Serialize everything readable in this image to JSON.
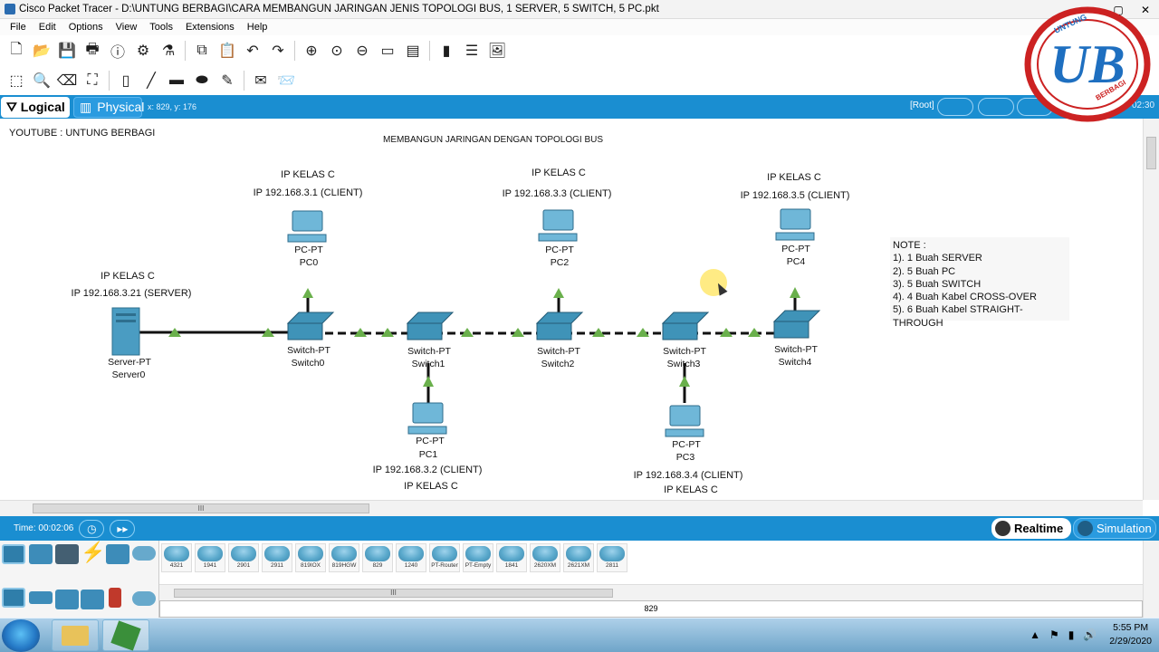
{
  "window": {
    "title": "Cisco Packet Tracer - D:\\UNTUNG BERBAGI\\CARA MEMBANGUN JARINGAN JENIS TOPOLOGI BUS, 1 SERVER, 5 SWITCH, 5 PC.pkt"
  },
  "menu": [
    "File",
    "Edit",
    "Options",
    "View",
    "Tools",
    "Extensions",
    "Help"
  ],
  "workspace": {
    "logical": "Logical",
    "physical": "Physical",
    "coords": "x: 829, y: 176",
    "root": "[Root]",
    "clock_partial": "02:30"
  },
  "canvas": {
    "youtube_label": "YOUTUBE : UNTUNG BERBAGI",
    "heading": "MEMBANGUN JARINGAN DENGAN TOPOLOGI BUS",
    "pc0": {
      "class": "IP KELAS C",
      "ip": "IP 192.168.3.1 (CLIENT)",
      "type": "PC-PT",
      "name": "PC0"
    },
    "pc2": {
      "class": "IP KELAS C",
      "ip": "IP 192.168.3.3  (CLIENT)",
      "type": "PC-PT",
      "name": "PC2"
    },
    "pc4": {
      "class": "IP KELAS C",
      "ip": "IP 192.168.3.5 (CLIENT)",
      "type": "PC-PT",
      "name": "PC4"
    },
    "server": {
      "class": "IP KELAS C",
      "ip": "IP 192.168.3.21 (SERVER)",
      "type": "Server-PT",
      "name": "Server0"
    },
    "pc1": {
      "type": "PC-PT",
      "name": "PC1",
      "ip": "IP 192.168.3.2  (CLIENT)",
      "class": "IP KELAS C"
    },
    "pc3": {
      "type": "PC-PT",
      "name": "PC3",
      "ip": "IP 192.168.3.4 (CLIENT)",
      "class": "IP KELAS C"
    },
    "switches": [
      {
        "type": "Switch-PT",
        "name": "Switch0"
      },
      {
        "type": "Switch-PT",
        "name": "Switch1"
      },
      {
        "type": "Switch-PT",
        "name": "Switch2"
      },
      {
        "type": "Switch-PT",
        "name": "Switch3"
      },
      {
        "type": "Switch-PT",
        "name": "Switch4"
      }
    ],
    "note": {
      "title": "NOTE :",
      "items": [
        "1). 1 Buah SERVER",
        "2). 5 Buah PC",
        "3). 5 Buah SWITCH",
        "4). 4 Buah Kabel CROSS-OVER",
        "5). 6 Buah Kabel STRAIGHT-THROUGH"
      ]
    }
  },
  "status": {
    "time": "Time: 00:02:06",
    "realtime": "Realtime",
    "simulation": "Simulation"
  },
  "devices": [
    "4321",
    "1941",
    "2901",
    "2911",
    "819IOX",
    "819HGW",
    "829",
    "1240",
    "PT-Router",
    "PT-Empty",
    "1841",
    "2620XM",
    "2621XM",
    "2811"
  ],
  "device_name_field": "829",
  "scroll_grip": "III",
  "taskbar": {
    "time": "5:55 PM",
    "date": "2/29/2020"
  },
  "logo": {
    "letters": "UB",
    "top_text": "UNTUNG",
    "bottom_text": "BERBAGI"
  },
  "colors": {
    "accent": "#1a8ed1",
    "link_green": "#6ab04c",
    "switch_teal": "#3f93b8"
  }
}
